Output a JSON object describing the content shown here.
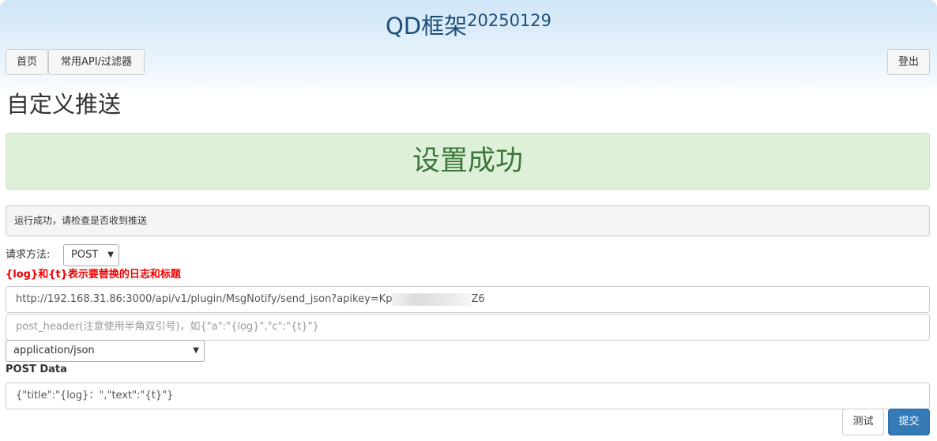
{
  "app": {
    "title": "QD框架",
    "version": "20250129"
  },
  "nav": {
    "home": "首页",
    "api": "常用API/过滤器",
    "logout": "登出"
  },
  "page": {
    "heading": "自定义推送"
  },
  "alert": {
    "message": "设置成功"
  },
  "result": {
    "text": "运行成功，请检查是否收到推送"
  },
  "form": {
    "method_label": "请求方法:",
    "method_value": "POST",
    "hint": "{log}和{t}表示要替换的日志和标题",
    "url_prefix": "http://192.168.31.86:3000/api/v1/plugin/MsgNotify/send_json?apikey=Kp",
    "url_suffix": "Z6",
    "header_placeholder": "post_header(注意使用半角双引号)，如{\"a\":\"{log}\",\"c\":\"{t}\"}",
    "content_type": "application/json",
    "post_data_label": "POST Data",
    "post_data_value": "{\"title\":\"{log}：\",\"text\":\"{t}\"}"
  },
  "buttons": {
    "test": "测试",
    "submit": "提交"
  },
  "icons": {
    "select": "chevron-down-icon"
  }
}
